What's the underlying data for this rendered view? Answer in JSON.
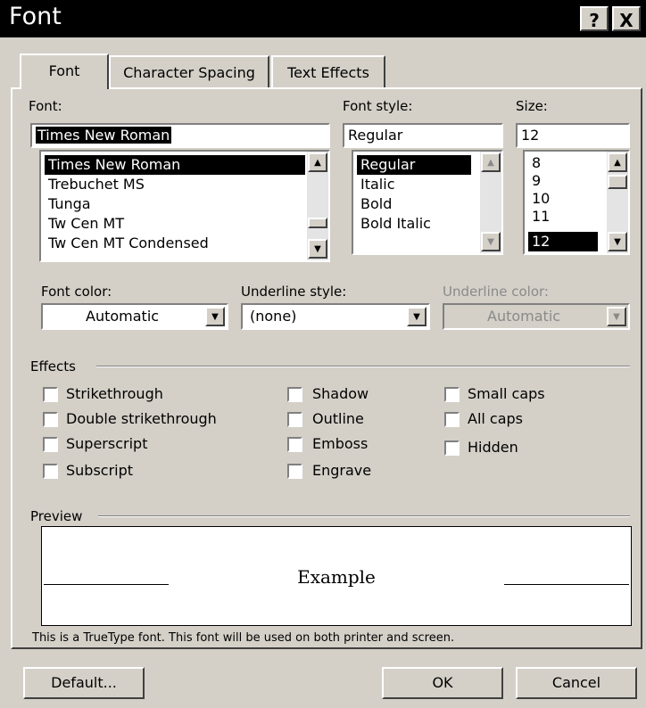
{
  "window": {
    "title": "Font",
    "help_button": "?",
    "close_button": "X"
  },
  "tabs": [
    {
      "label": "Font",
      "active": true
    },
    {
      "label": "Character Spacing",
      "active": false
    },
    {
      "label": "Text Effects",
      "active": false
    }
  ],
  "font": {
    "label": "Font:",
    "value": "Times New Roman",
    "options": [
      "Times New Roman",
      "Trebuchet MS",
      "Tunga",
      "Tw Cen MT",
      "Tw Cen MT Condensed"
    ],
    "selected": "Times New Roman"
  },
  "font_style": {
    "label": "Font style:",
    "value": "Regular",
    "options": [
      "Regular",
      "Italic",
      "Bold",
      "Bold Italic"
    ],
    "selected": "Regular"
  },
  "size": {
    "label": "Size:",
    "value": "12",
    "options": [
      "8",
      "9",
      "10",
      "11",
      "12"
    ],
    "selected": "12"
  },
  "font_color": {
    "label": "Font color:",
    "value": "Automatic"
  },
  "underline_style": {
    "label": "Underline style:",
    "value": "(none)"
  },
  "underline_color": {
    "label": "Underline color:",
    "value": "Automatic",
    "disabled": true
  },
  "effects": {
    "label": "Effects",
    "items": [
      {
        "label": "Strikethrough",
        "checked": false
      },
      {
        "label": "Double strikethrough",
        "checked": false
      },
      {
        "label": "Superscript",
        "checked": false
      },
      {
        "label": "Subscript",
        "checked": false
      },
      {
        "label": "Shadow",
        "checked": false
      },
      {
        "label": "Outline",
        "checked": false
      },
      {
        "label": "Emboss",
        "checked": false
      },
      {
        "label": "Engrave",
        "checked": false
      },
      {
        "label": "Small caps",
        "checked": false
      },
      {
        "label": "All caps",
        "checked": false
      },
      {
        "label": "Hidden",
        "checked": false
      }
    ]
  },
  "preview": {
    "label": "Preview",
    "sample": "Example",
    "note": "This is a TrueType font. This font will be used on both printer and screen."
  },
  "buttons": {
    "default": "Default...",
    "ok": "OK",
    "cancel": "Cancel"
  },
  "colors": {
    "dialog_bg": "#d4d0c8",
    "title_bar": "#000000",
    "selection": "#000000",
    "disabled_text": "#8a8a8a"
  }
}
